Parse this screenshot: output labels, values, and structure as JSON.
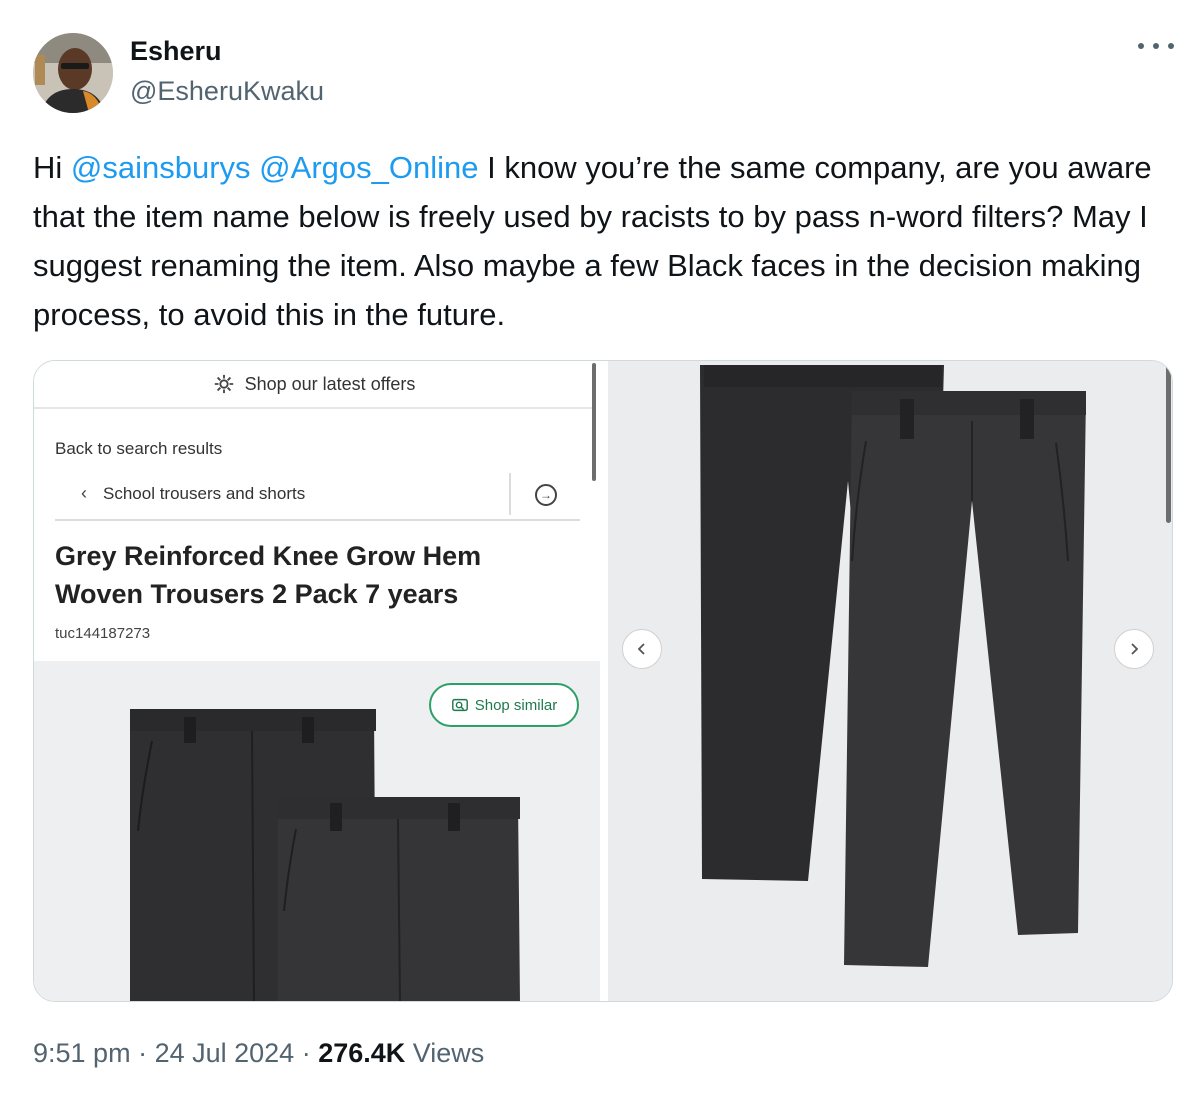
{
  "author": {
    "display_name": "Esheru",
    "handle": "@EsheruKwaku"
  },
  "tweet": {
    "text_parts": {
      "greeting": "Hi ",
      "mention_1": "@sainsburys",
      "space": " ",
      "mention_2": "@Argos_Online",
      "body": " I know you’re the same company, are you aware that the item name below is freely used by racists to by pass n-word filters? May I suggest renaming the item. Also maybe a few Black faces in the decision making process, to avoid this in the future."
    }
  },
  "media": {
    "screenshot": {
      "offers_label": "Shop our latest offers",
      "back_label": "Back to search results",
      "breadcrumb_label": "School trousers and shorts",
      "product_title": "Grey Reinforced Knee Grow Hem Woven Trousers 2 Pack 7 years",
      "product_code": "tuc144187273",
      "shop_similar_label": "Shop similar"
    },
    "icons": {
      "offers": "gear-icon",
      "back": "chevron-left-icon",
      "next": "arrow-right-circle-icon",
      "shop_similar": "camera-search-icon",
      "gallery_prev": "chevron-left-icon",
      "gallery_next": "chevron-right-icon"
    },
    "accent_color": "#2e9e6a"
  },
  "footer": {
    "time": "9:51 pm",
    "dot_1": " · ",
    "date": "24 Jul 2024",
    "dot_2": " · ",
    "views_count": "276.4K",
    "views_label": " Views"
  },
  "colors": {
    "link": "#1d9bf0",
    "muted": "#536471",
    "text": "#0f1419"
  }
}
